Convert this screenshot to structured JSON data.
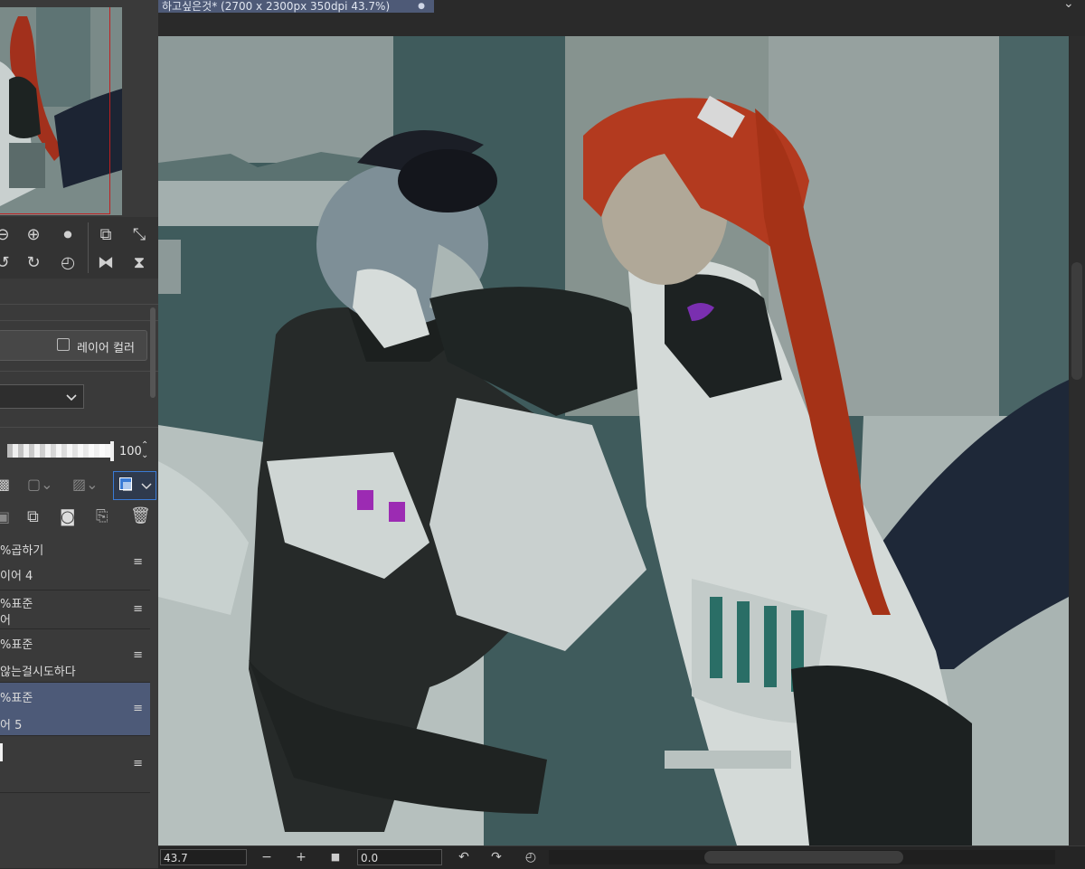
{
  "document_tab": {
    "title": "하고싶은것* (2700 x 2300px 350dpi 43.7%)",
    "close_glyph": "●"
  },
  "navigator": {
    "row1": [
      "zoom-out",
      "zoom-in",
      "fit-page",
      "actual-size",
      "fit-window"
    ],
    "row2": [
      "rotate-left",
      "rotate-right",
      "reset-rotation",
      "flip-horizontal",
      "flip-vertical"
    ]
  },
  "layer_props": {
    "layer_color_label": "레이어 컬러",
    "blend_mode": "",
    "opacity_value": "100"
  },
  "layers": [
    {
      "mode": "%곱하기",
      "name": "이어 4",
      "selected": false
    },
    {
      "mode": "%표준",
      "name": "어",
      "selected": false
    },
    {
      "mode": "%표준",
      "name": "않는걸시도하다",
      "selected": false
    },
    {
      "mode": "%표준",
      "name": "어 5",
      "selected": true
    },
    {
      "mode": "",
      "name": "",
      "selected": false
    }
  ],
  "bottom_bar": {
    "zoom_value": "43.7",
    "zoom_out": "−",
    "zoom_in": "+",
    "stop": "■",
    "rotation_value": "0.0"
  },
  "colors": {
    "panel_bg": "#3a3a3a",
    "selected_layer": "#4d5a78",
    "tab_bg": "#4e5a77",
    "accent_blue": "#3a7bd5"
  }
}
